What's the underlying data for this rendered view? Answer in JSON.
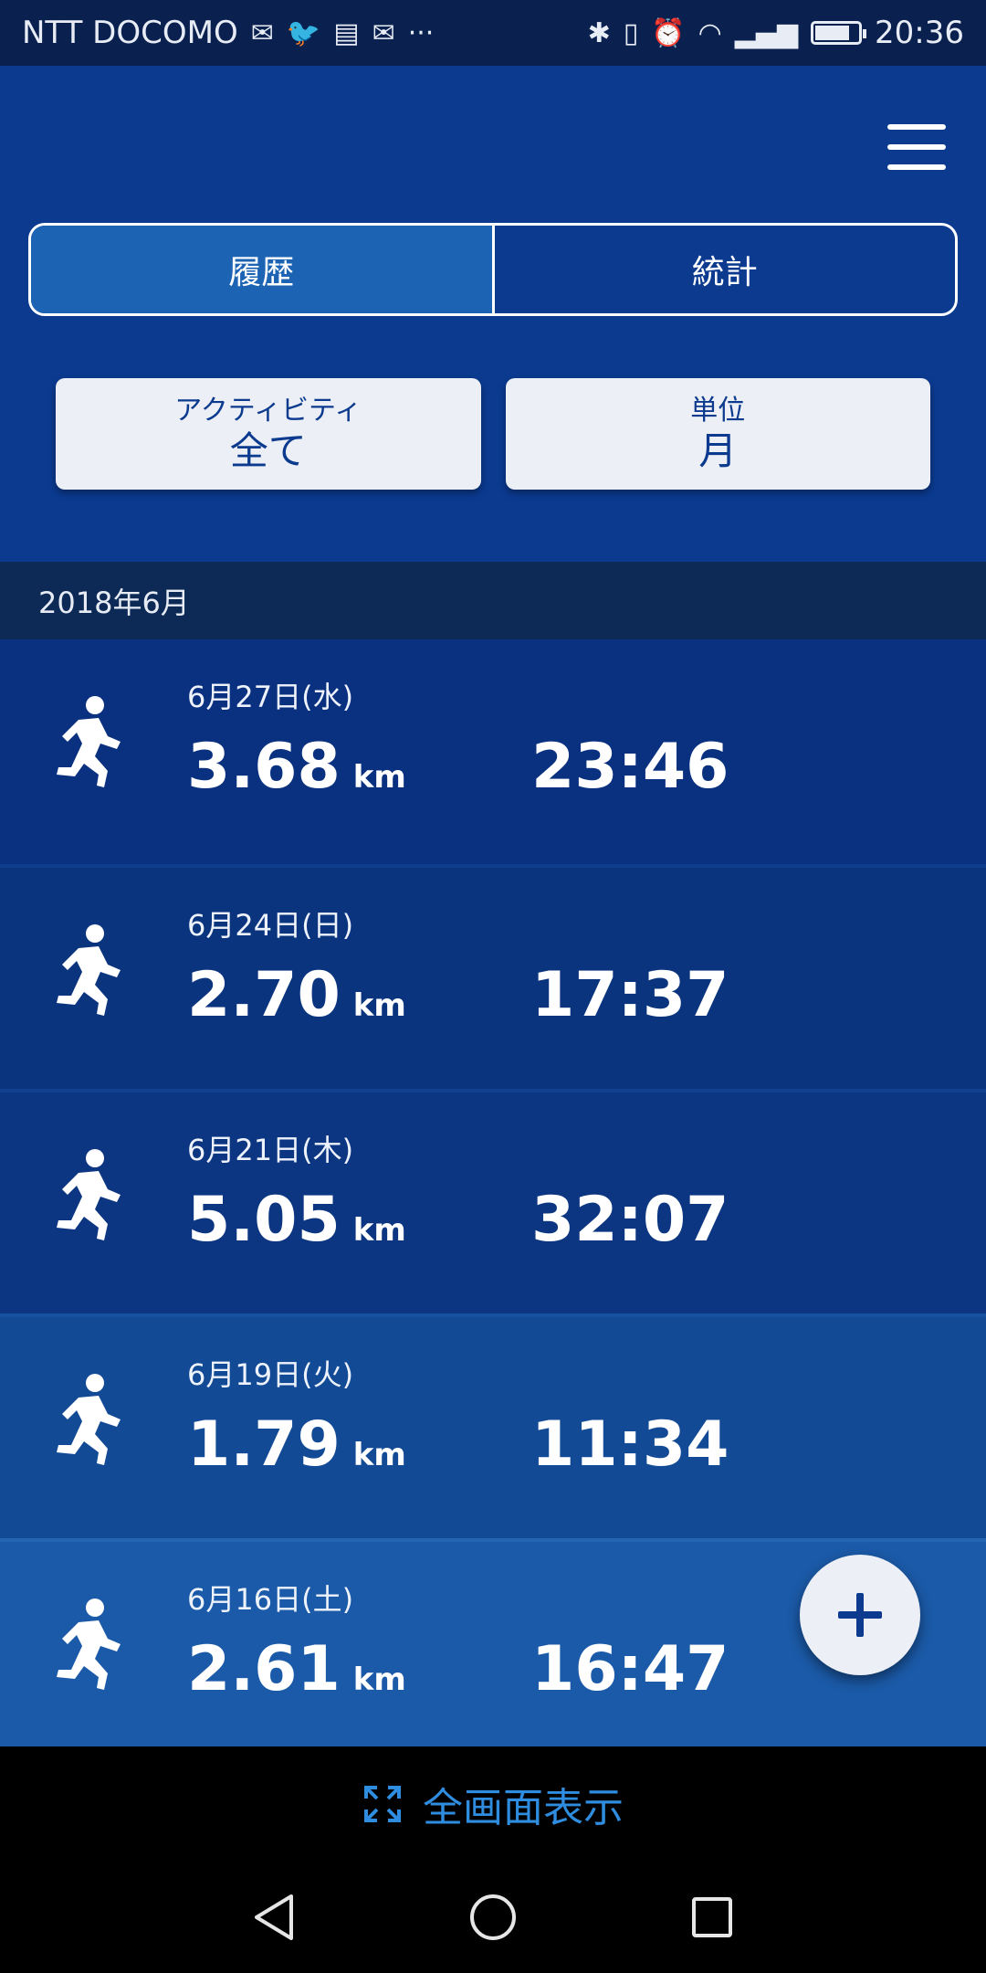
{
  "status_bar": {
    "carrier": "NTT DOCOMO",
    "more": "···",
    "time": "20:36"
  },
  "tabs": [
    {
      "label": "履歴",
      "active": true
    },
    {
      "label": "統計",
      "active": false
    }
  ],
  "filters": {
    "activity": {
      "label": "アクティビティ",
      "value": "全て"
    },
    "unit": {
      "label": "単位",
      "value": "月"
    }
  },
  "section": {
    "title": "2018年6月"
  },
  "activities": [
    {
      "date": "6月27日(水)",
      "distance": "3.68",
      "unit": "km",
      "time": "23:46"
    },
    {
      "date": "6月24日(日)",
      "distance": "2.70",
      "unit": "km",
      "time": "17:37"
    },
    {
      "date": "6月21日(木)",
      "distance": "5.05",
      "unit": "km",
      "time": "32:07"
    },
    {
      "date": "6月19日(火)",
      "distance": "1.79",
      "unit": "km",
      "time": "11:34"
    },
    {
      "date": "6月16日(土)",
      "distance": "2.61",
      "unit": "km",
      "time": "16:47"
    }
  ],
  "fullscreen": {
    "label": "全画面表示"
  },
  "colors": {
    "primary": "#0b3a8f",
    "accent": "#2f8de0",
    "button_bg": "#eceff5"
  }
}
